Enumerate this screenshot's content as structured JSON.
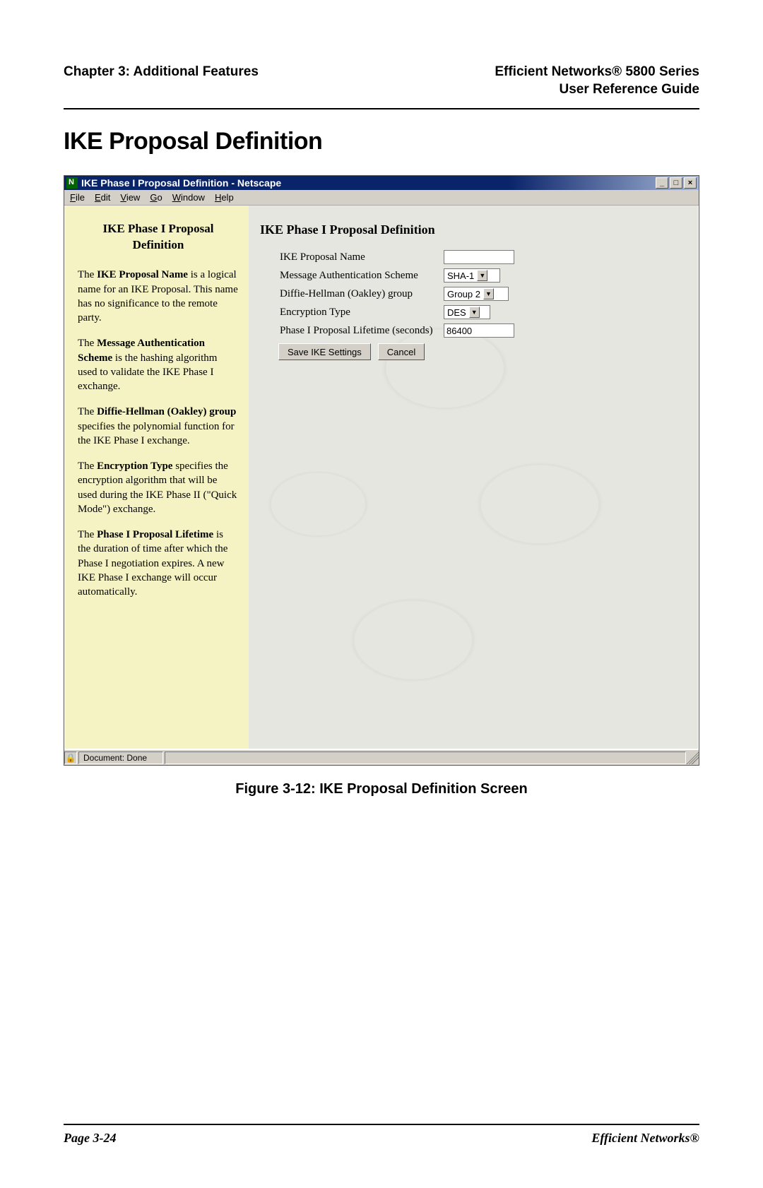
{
  "header": {
    "left": "Chapter 3: Additional Features",
    "right_line1": "Efficient Networks® 5800 Series",
    "right_line2": "User Reference Guide"
  },
  "section_title": "IKE Proposal Definition",
  "window": {
    "title": "IKE Phase I Proposal Definition - Netscape",
    "menus": [
      "File",
      "Edit",
      "View",
      "Go",
      "Window",
      "Help"
    ],
    "win_buttons": {
      "min": "_",
      "max": "□",
      "close": "×"
    }
  },
  "sidebar": {
    "title": "IKE Phase I Proposal Definition",
    "p1_a": "The ",
    "p1_b": "IKE Proposal Name",
    "p1_c": " is a logical name for an IKE Proposal. This name has no significance to the remote party.",
    "p2_a": "The ",
    "p2_b": "Message Authentication Scheme",
    "p2_c": " is the hashing algorithm used to validate the IKE Phase I exchange.",
    "p3_a": "The ",
    "p3_b": "Diffie-Hellman (Oakley) group",
    "p3_c": " specifies the polynomial function for the IKE Phase I exchange.",
    "p4_a": "The ",
    "p4_b": "Encryption Type",
    "p4_c": " specifies the encryption algorithm that will be used during the IKE Phase II (\"Quick Mode\") exchange.",
    "p5_a": "The ",
    "p5_b": "Phase I Proposal Lifetime",
    "p5_c": " is the duration of time after which the Phase I negotiation expires. A new IKE Phase I exchange will occur automatically."
  },
  "form": {
    "heading": "IKE Phase I Proposal Definition",
    "labels": {
      "name": "IKE Proposal Name",
      "mas": "Message Authentication Scheme",
      "dh": "Diffie-Hellman (Oakley) group",
      "enc": "Encryption Type",
      "life": "Phase I Proposal Lifetime (seconds)"
    },
    "values": {
      "name": "",
      "mas": "SHA-1",
      "dh": "Group 2",
      "enc": "DES",
      "life": "86400"
    },
    "buttons": {
      "save": "Save IKE Settings",
      "cancel": "Cancel"
    }
  },
  "status": {
    "text": "Document: Done"
  },
  "figure_caption": "Figure 3-12:  IKE Proposal Definition Screen",
  "footer": {
    "left": "Page 3-24",
    "right": "Efficient Networks®"
  }
}
